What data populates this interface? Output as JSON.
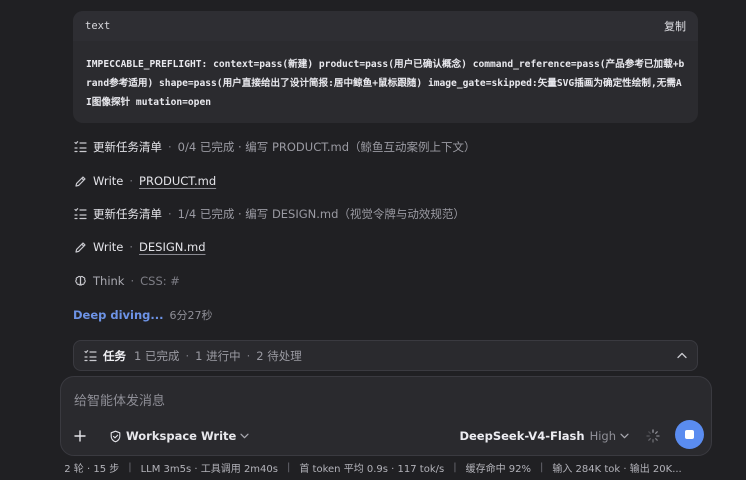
{
  "code_block": {
    "language": "text",
    "copy_label": "复制",
    "content": "IMPECCABLE_PREFLIGHT: context=pass(新建) product=pass(用户已确认概念) command_reference=pass(产品参考已加载+brand参考适用) shape=pass(用户直接给出了设计简报:居中鲸鱼+鼠标跟随) image_gate=skipped:矢量SVG插画为确定性绘制,无需AI图像探针 mutation=open"
  },
  "activity": [
    {
      "type": "tasks",
      "icon": "task-list-icon",
      "label": "更新任务清单",
      "detail": "0/4 已完成 · 编写 PRODUCT.md（鲸鱼互动案例上下文）"
    },
    {
      "type": "write",
      "icon": "pencil-icon",
      "label": "Write",
      "file": "PRODUCT.md"
    },
    {
      "type": "tasks",
      "icon": "task-list-icon",
      "label": "更新任务清单",
      "detail": "1/4 已完成 · 编写 DESIGN.md（视觉令牌与动效规范）"
    },
    {
      "type": "write",
      "icon": "pencil-icon",
      "label": "Write",
      "file": "DESIGN.md"
    },
    {
      "type": "think",
      "icon": "brain-icon",
      "label": "Think",
      "detail": "CSS: #"
    }
  ],
  "deep_diving": {
    "label": "Deep diving...",
    "duration": "6分27秒"
  },
  "task_bar": {
    "title": "任务",
    "completed": "1 已完成",
    "in_progress": "1 进行中",
    "pending": "2 待处理"
  },
  "composer": {
    "placeholder": "给智能体发消息",
    "workspace_label": "Workspace Write",
    "model_name": "DeepSeek-V4-Flash",
    "model_level": "High"
  },
  "status_bar": {
    "turns": "2 轮 · 15 步",
    "llm": "LLM 3m5s · 工具调用 2m40s",
    "first_token": "首 token 平均 0.9s · 117 tok/s",
    "cache": "缓存命中 92%",
    "io": "输入 284K tok · 输出 20K..."
  },
  "colors": {
    "background": "#202023",
    "accent": "#5a8cf0",
    "link_blue": "#6d93e6"
  }
}
